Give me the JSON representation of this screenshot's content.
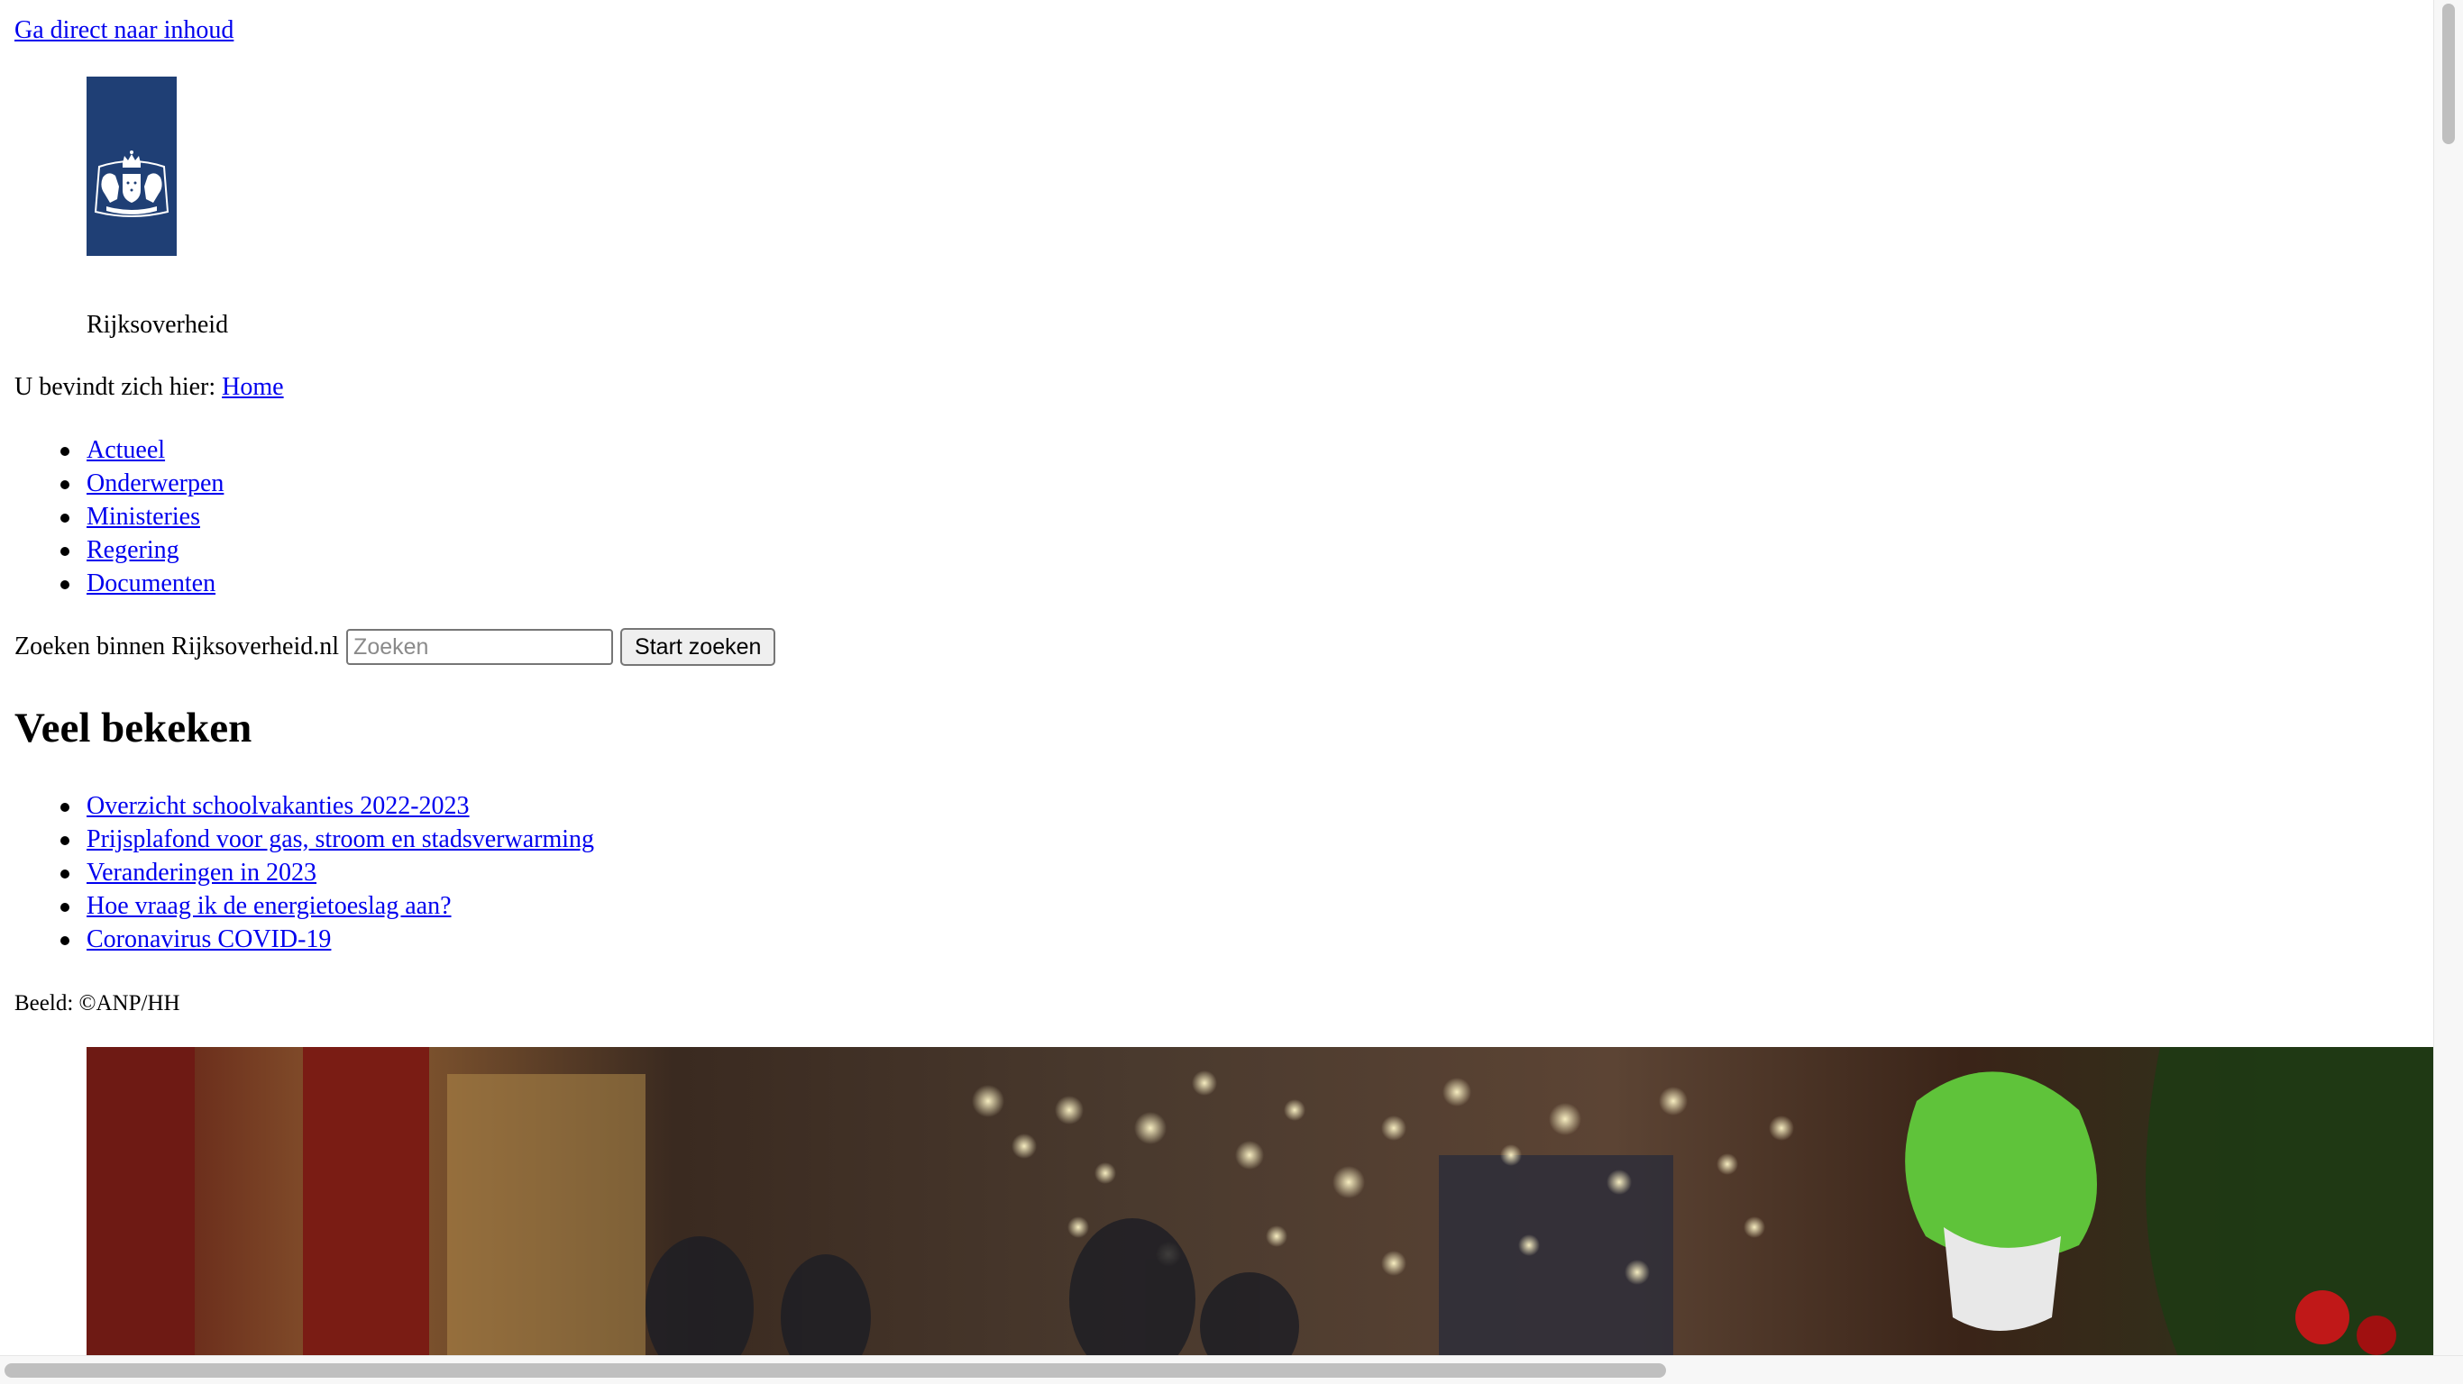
{
  "skip_link": "Ga direct naar inhoud",
  "brand": {
    "name": "Rijksoverheid",
    "logo_color": "#1f3f75"
  },
  "breadcrumb": {
    "label": "U bevindt zich hier:",
    "home": "Home"
  },
  "nav": {
    "items": [
      {
        "label": "Actueel"
      },
      {
        "label": "Onderwerpen"
      },
      {
        "label": "Ministeries"
      },
      {
        "label": "Regering"
      },
      {
        "label": "Documenten"
      }
    ]
  },
  "search": {
    "label": "Zoeken binnen Rijksoverheid.nl",
    "placeholder": "Zoeken",
    "value": "",
    "button": "Start zoeken"
  },
  "popular": {
    "heading": "Veel bekeken",
    "items": [
      {
        "label": "Overzicht schoolvakanties 2022-2023"
      },
      {
        "label": "Prijsplafond voor gas, stroom en stadsverwarming"
      },
      {
        "label": "Veranderingen in 2023"
      },
      {
        "label": "Hoe vraag ik de energietoeslag aan?"
      },
      {
        "label": "Coronavirus COVID-19"
      }
    ]
  },
  "hero": {
    "credit": "Beeld: ©ANP/HH"
  },
  "colors": {
    "link": "#0000ee",
    "logo_blue": "#1f3f75"
  }
}
